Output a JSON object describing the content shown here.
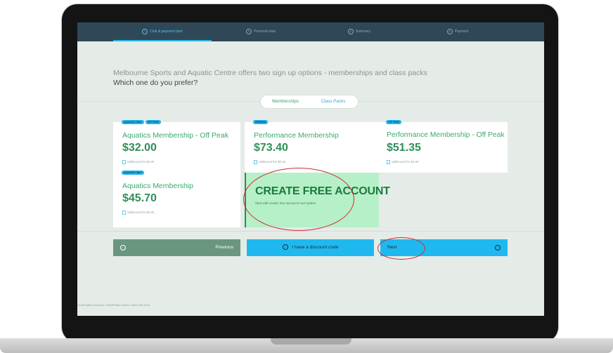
{
  "steps": [
    {
      "num": "1",
      "label": "Club & payment plan",
      "active": true
    },
    {
      "num": "2",
      "label": "Personal data",
      "active": false
    },
    {
      "num": "3",
      "label": "Summary",
      "active": false
    },
    {
      "num": "4",
      "label": "Payment",
      "active": false
    }
  ],
  "intro": "Melbourne Sports and Aquatic Centre offers two sign up options - memberships and class packs",
  "question": "Which one do you prefer?",
  "toggle": {
    "memberships": "Memberships",
    "class_packs": "Class Packs",
    "selected": "Memberships"
  },
  "cards": [
    {
      "badges": [
        "AQUATICS ONLY",
        "OFF PEAK"
      ],
      "name": "Aquatics Membership - Off Peak",
      "price": "$32.00",
      "fee": "additional fee $0.00"
    },
    {
      "badges": [
        "PREMIUM"
      ],
      "name": "Performance Membership",
      "price": "$73.40",
      "fee": "additional fee $0.00"
    },
    {
      "badges": [
        "OFF PEAK"
      ],
      "name": "Performance Membership - Off Peak",
      "price": "$51.35",
      "fee": "additional fee $0.00"
    },
    {
      "badges": [
        "AQUATICS ONLY"
      ],
      "name": "Aquatics Membership",
      "price": "$45.70",
      "fee": "additional fee $0.00"
    }
  ],
  "free_account": {
    "title": "CREATE FREE ACCOUNT",
    "subtitle": "Start with a basic free account in our system"
  },
  "buttons": {
    "previous": "Previous",
    "discount": "I have a discount code",
    "next": "Next",
    "prev_icon": "←",
    "discount_icon": "→",
    "next_icon": "→"
  },
  "footer": "LA All rights reserved. ClientPortal version 4.843.318.1115",
  "colors": {
    "nav": "#2f4858",
    "accent_blue": "#1fb9ef",
    "brand_green": "#2f8f59",
    "free_bg": "#b6f0c8",
    "annotation_red": "#d4282f"
  }
}
